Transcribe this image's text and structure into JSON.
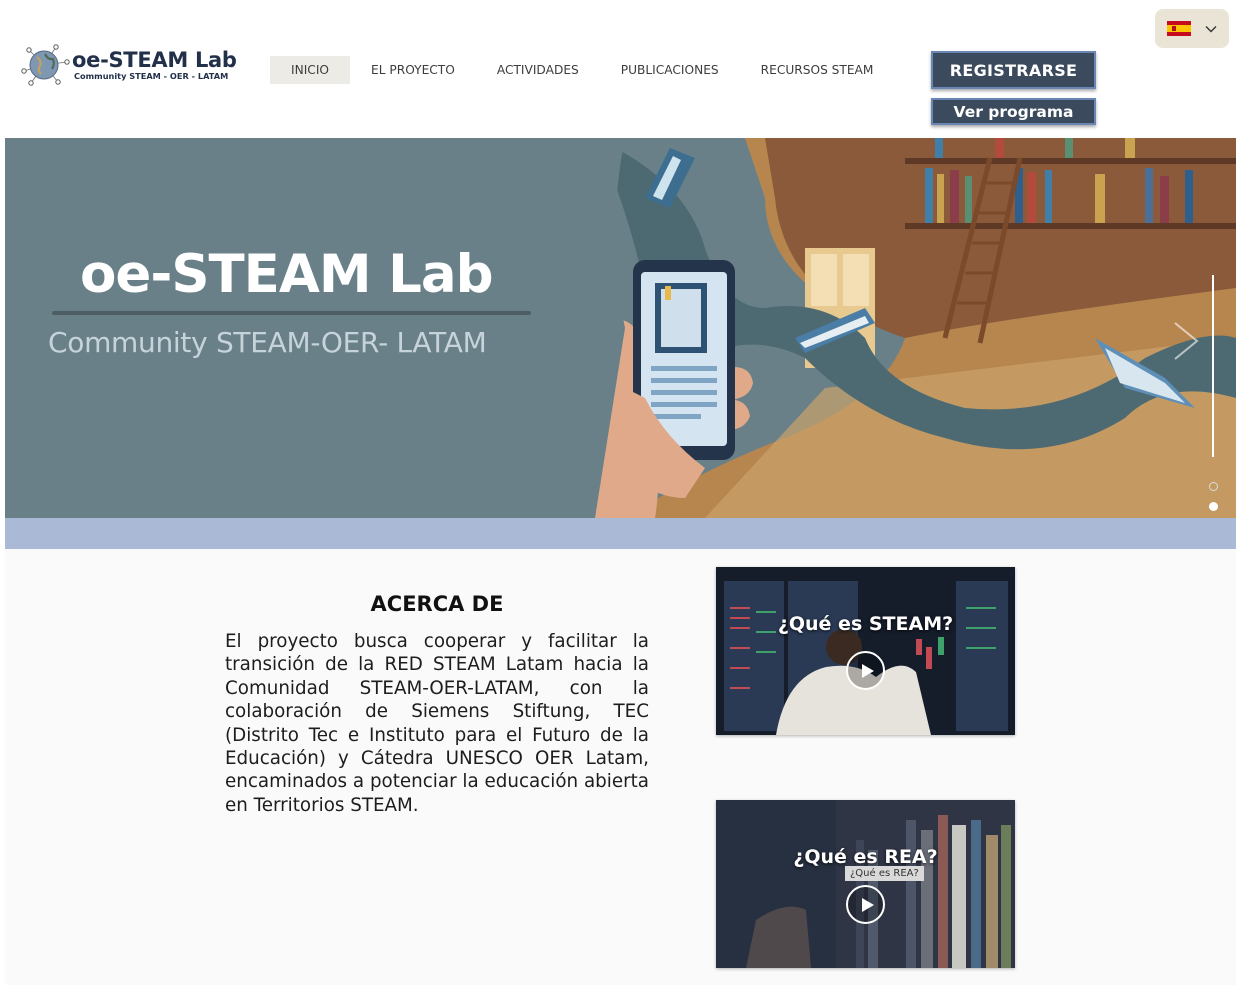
{
  "header": {
    "logo_title": "oe-STEAM Lab",
    "logo_subtitle": "Community STEAM - OER - LATAM",
    "nav": [
      {
        "label": "INICIO",
        "active": true
      },
      {
        "label": "EL PROYECTO",
        "active": false
      },
      {
        "label": "ACTIVIDADES",
        "active": false
      },
      {
        "label": "PUBLICACIONES",
        "active": false
      },
      {
        "label": "RECURSOS STEAM",
        "active": false
      }
    ],
    "register_label": "REGISTRARSE",
    "program_label": "Ver programa",
    "language": {
      "flag_icon": "spain-flag-icon",
      "selected": "es"
    }
  },
  "hero": {
    "title": "oe-STEAM Lab",
    "subtitle": "Community STEAM-OER- LATAM",
    "slides": 2,
    "active_slide": 2
  },
  "about": {
    "title": "ACERCA DE",
    "text": "El proyecto busca cooperar y facilitar la transición de la RED STEAM Latam hacia la Comunidad STEAM-OER-LATAM, con la colaboración de Siemens Stiftung, TEC (Distrito Tec e Instituto para el Futuro de la Educación) y Cátedra UNESCO OER Latam, encaminados a potenciar la educación abierta en Territorios STEAM."
  },
  "videos": [
    {
      "title": "¿Qué es STEAM?",
      "tooltip": ""
    },
    {
      "title": "¿Qué es REA?",
      "tooltip": "¿Qué es REA?"
    }
  ],
  "colors": {
    "brand_navy": "#22304a",
    "button_bg": "#3b4a5c",
    "button_border": "#6a86b4",
    "hero_bg": "#6a8089",
    "hero_strip": "#a9b9d6",
    "active_nav_bg": "#ecebe6"
  }
}
